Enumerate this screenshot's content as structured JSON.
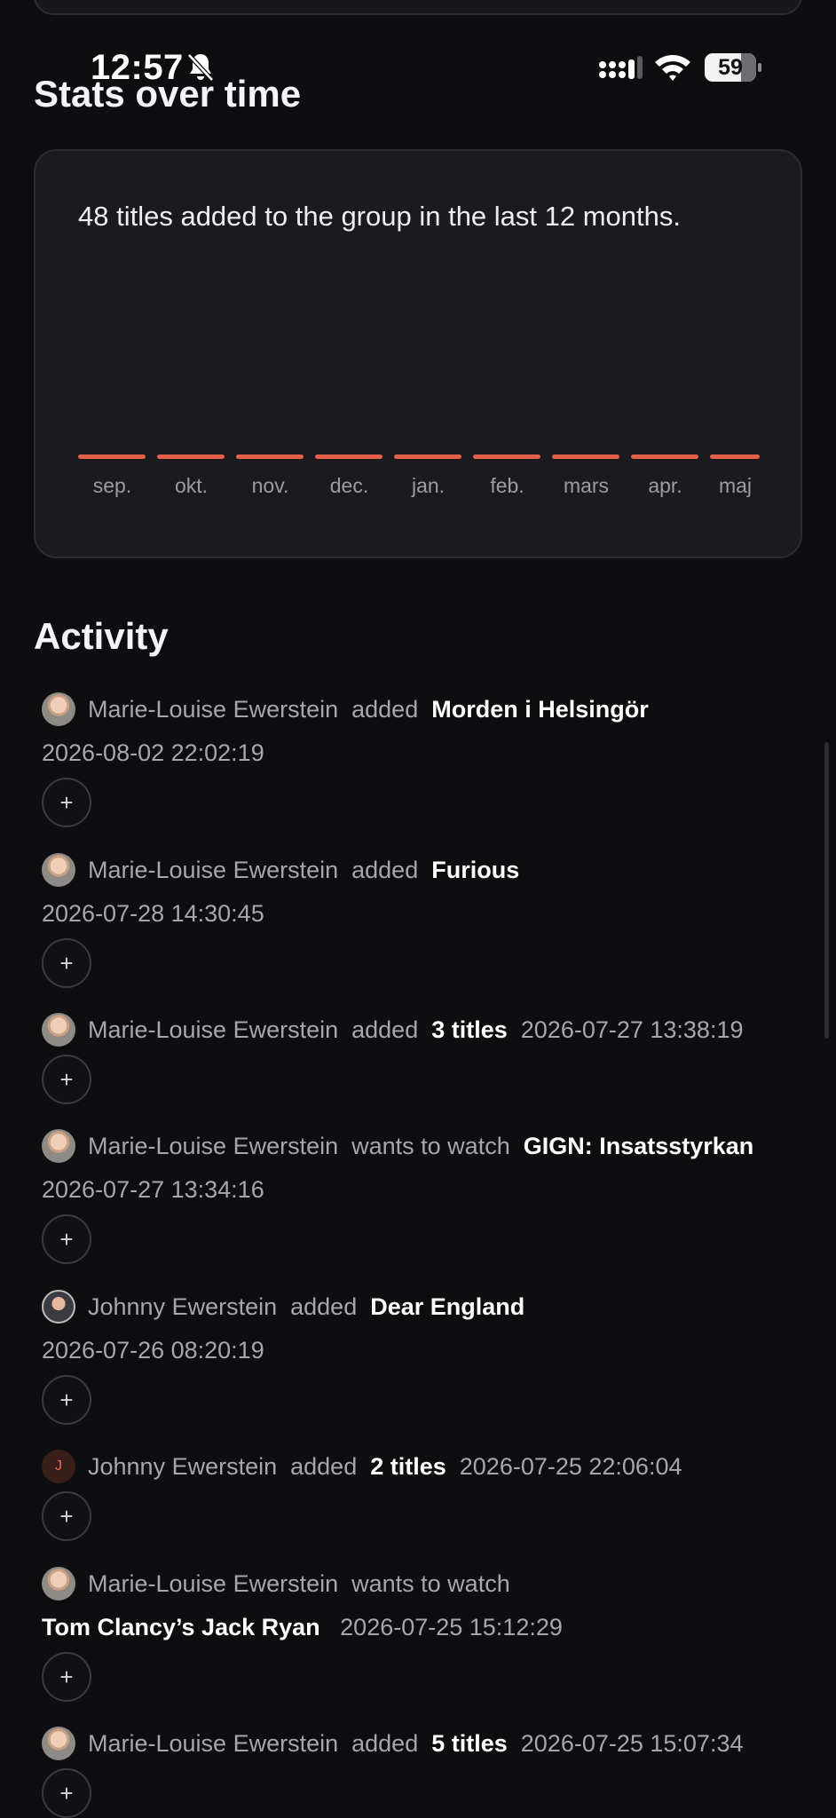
{
  "status_bar": {
    "time": "12:57",
    "battery": "59"
  },
  "stats": {
    "title": "Stats over time",
    "summary": "48 titles added to the group in the last 12 months.",
    "months": [
      "sep.",
      "okt.",
      "nov.",
      "dec.",
      "jan.",
      "feb.",
      "mars",
      "apr.",
      "maj"
    ],
    "accent": "#e4604a"
  },
  "activity": {
    "title": "Activity",
    "add_label": "+",
    "items": [
      {
        "user": "Marie-Louise Ewerstein",
        "verb": "added",
        "title": "Morden i Helsingör",
        "time": "2026-08-02 22:02:19"
      },
      {
        "user": "Marie-Louise Ewerstein",
        "verb": "added",
        "title": "Furious",
        "time": "2026-07-28 14:30:45"
      },
      {
        "user": "Marie-Louise Ewerstein",
        "verb": "added",
        "title": "3 titles",
        "time": "2026-07-27 13:38:19"
      },
      {
        "user": "Marie-Louise Ewerstein",
        "verb": "wants to watch",
        "title": "GIGN: Insatsstyrkan",
        "time": "2026-07-27 13:34:16"
      },
      {
        "user": "Johnny Ewerstein",
        "verb": "added",
        "title": "Dear England",
        "time": "2026-07-26 08:20:19"
      },
      {
        "user": "Johnny Ewerstein",
        "avatar_initial": "J",
        "verb": "added",
        "title": "2 titles",
        "time": "2026-07-25 22:06:04"
      },
      {
        "user": "Marie-Louise Ewerstein",
        "verb": "wants to watch",
        "title": "Tom Clancy’s Jack Ryan",
        "time": "2026-07-25 15:12:29"
      },
      {
        "user": "Marie-Louise Ewerstein",
        "verb": "added",
        "title": "5 titles",
        "time": "2026-07-25 15:07:34"
      }
    ]
  }
}
